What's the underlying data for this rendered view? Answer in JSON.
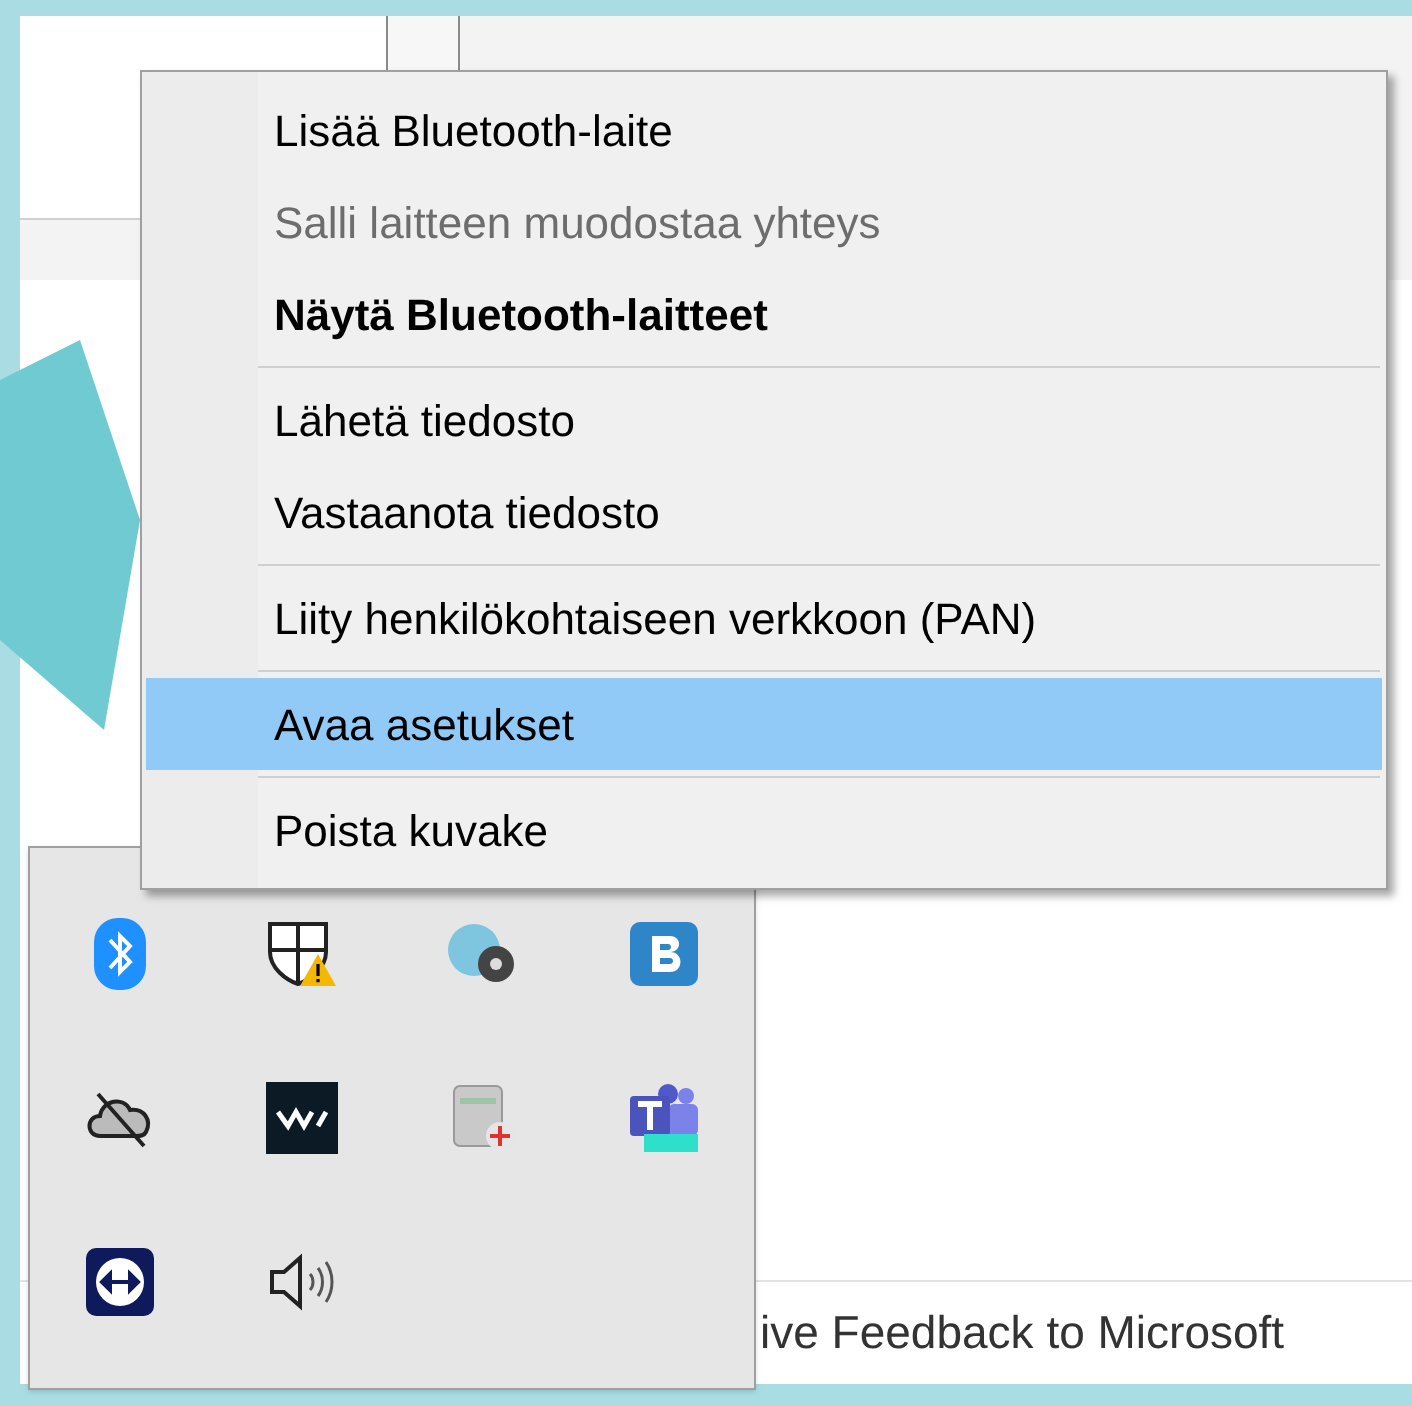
{
  "context_menu": {
    "items": [
      {
        "kind": "item",
        "label": "Lisää Bluetooth-laite",
        "disabled": false,
        "default": false,
        "selected": false
      },
      {
        "kind": "item",
        "label": "Salli laitteen muodostaa yhteys",
        "disabled": true,
        "default": false,
        "selected": false
      },
      {
        "kind": "item",
        "label": "Näytä Bluetooth-laitteet",
        "disabled": false,
        "default": true,
        "selected": false
      },
      {
        "kind": "separator"
      },
      {
        "kind": "item",
        "label": "Lähetä tiedosto",
        "disabled": false,
        "default": false,
        "selected": false
      },
      {
        "kind": "item",
        "label": "Vastaanota tiedosto",
        "disabled": false,
        "default": false,
        "selected": false
      },
      {
        "kind": "separator"
      },
      {
        "kind": "item",
        "label": "Liity henkilökohtaiseen verkkoon (PAN)",
        "disabled": false,
        "default": false,
        "selected": false
      },
      {
        "kind": "separator"
      },
      {
        "kind": "item",
        "label": "Avaa asetukset",
        "disabled": false,
        "default": false,
        "selected": true
      },
      {
        "kind": "separator"
      },
      {
        "kind": "item",
        "label": "Poista kuvake",
        "disabled": false,
        "default": false,
        "selected": false
      }
    ]
  },
  "feedback_link": "ive Feedback to Microsoft"
}
